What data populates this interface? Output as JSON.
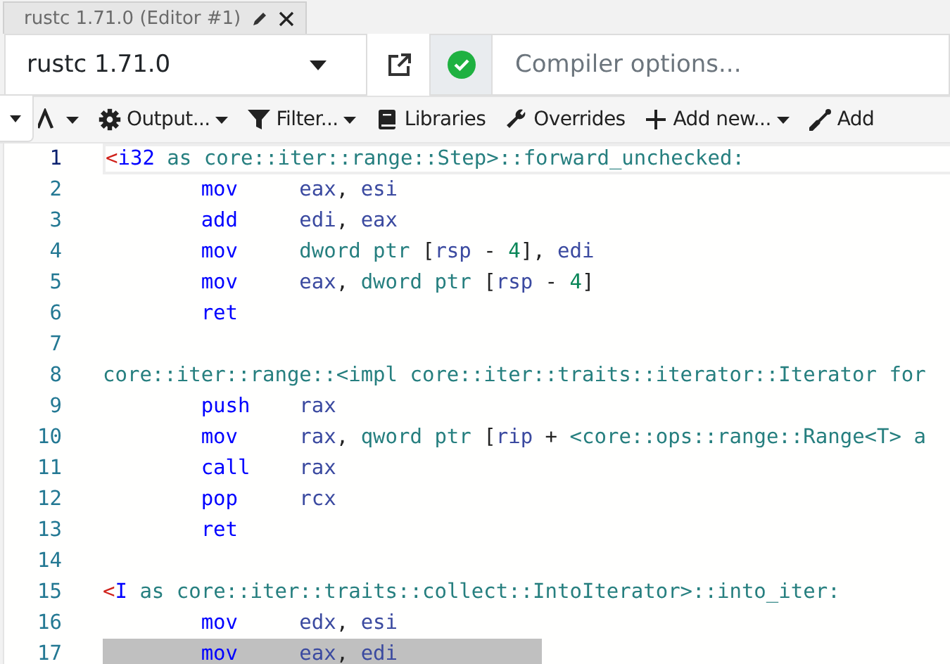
{
  "tab": {
    "title": "rustc 1.71.0 (Editor #1)"
  },
  "compiler": {
    "name": "rustc 1.71.0",
    "options_placeholder": "Compiler options..."
  },
  "toolbar": [
    {
      "dropdown": true
    },
    {
      "label": "Output...",
      "dropdown": true
    },
    {
      "label": "Filter...",
      "dropdown": true
    },
    {
      "label": "Libraries",
      "dropdown": false
    },
    {
      "label": "Overrides",
      "dropdown": false
    },
    {
      "label": "Add new...",
      "dropdown": true
    },
    {
      "label": "Add",
      "dropdown": false
    }
  ],
  "lines": [
    {
      "number": "1",
      "current": true,
      "highlighted": false,
      "kind": "label",
      "tokens": [
        {
          "kind": "angle",
          "text": "<"
        },
        {
          "kind": "type",
          "text": "i32"
        },
        {
          "kind": "name",
          "text": " as core::iter::range::Step>::forward_unchecked:"
        }
      ]
    },
    {
      "number": "2",
      "current": false,
      "highlighted": false,
      "kind": "instruction",
      "mnemonic": "mov",
      "tokens": [
        {
          "kind": "register",
          "text": "eax"
        },
        {
          "kind": "punct",
          "text": ", "
        },
        {
          "kind": "register",
          "text": "esi"
        }
      ]
    },
    {
      "number": "3",
      "current": false,
      "highlighted": false,
      "kind": "instruction",
      "mnemonic": "add",
      "tokens": [
        {
          "kind": "register",
          "text": "edi"
        },
        {
          "kind": "punct",
          "text": ", "
        },
        {
          "kind": "register",
          "text": "eax"
        }
      ]
    },
    {
      "number": "4",
      "current": false,
      "highlighted": false,
      "kind": "instruction",
      "mnemonic": "mov",
      "tokens": [
        {
          "kind": "name",
          "text": "dword ptr "
        },
        {
          "kind": "punct",
          "text": "["
        },
        {
          "kind": "register",
          "text": "rsp"
        },
        {
          "kind": "punct",
          "text": " - "
        },
        {
          "kind": "number",
          "text": "4"
        },
        {
          "kind": "punct",
          "text": "], "
        },
        {
          "kind": "register",
          "text": "edi"
        }
      ]
    },
    {
      "number": "5",
      "current": false,
      "highlighted": false,
      "kind": "instruction",
      "mnemonic": "mov",
      "tokens": [
        {
          "kind": "register",
          "text": "eax"
        },
        {
          "kind": "punct",
          "text": ", "
        },
        {
          "kind": "name",
          "text": "dword ptr "
        },
        {
          "kind": "punct",
          "text": "["
        },
        {
          "kind": "register",
          "text": "rsp"
        },
        {
          "kind": "punct",
          "text": " - "
        },
        {
          "kind": "number",
          "text": "4"
        },
        {
          "kind": "punct",
          "text": "]"
        }
      ]
    },
    {
      "number": "6",
      "current": false,
      "highlighted": false,
      "kind": "instruction",
      "mnemonic": "ret"
    },
    {
      "number": "7",
      "current": false,
      "highlighted": false,
      "kind": "blank"
    },
    {
      "number": "8",
      "current": false,
      "highlighted": false,
      "kind": "label",
      "tokens": [
        {
          "kind": "name",
          "text": "core::iter::range::<impl core::iter::traits::iterator::Iterator for"
        }
      ]
    },
    {
      "number": "9",
      "current": false,
      "highlighted": false,
      "kind": "instruction",
      "mnemonic": "push",
      "tokens": [
        {
          "kind": "register",
          "text": "rax"
        }
      ]
    },
    {
      "number": "10",
      "current": false,
      "highlighted": false,
      "kind": "instruction",
      "mnemonic": "mov",
      "tokens": [
        {
          "kind": "register",
          "text": "rax"
        },
        {
          "kind": "punct",
          "text": ", "
        },
        {
          "kind": "name",
          "text": "qword ptr "
        },
        {
          "kind": "punct",
          "text": "["
        },
        {
          "kind": "register",
          "text": "rip"
        },
        {
          "kind": "punct",
          "text": " + "
        },
        {
          "kind": "name",
          "text": "<core::ops::range::Range<T> a"
        }
      ]
    },
    {
      "number": "11",
      "current": false,
      "highlighted": false,
      "kind": "instruction",
      "mnemonic": "call",
      "tokens": [
        {
          "kind": "register",
          "text": "rax"
        }
      ]
    },
    {
      "number": "12",
      "current": false,
      "highlighted": false,
      "kind": "instruction",
      "mnemonic": "pop",
      "tokens": [
        {
          "kind": "register",
          "text": "rcx"
        }
      ]
    },
    {
      "number": "13",
      "current": false,
      "highlighted": false,
      "kind": "instruction",
      "mnemonic": "ret"
    },
    {
      "number": "14",
      "current": false,
      "highlighted": false,
      "kind": "blank"
    },
    {
      "number": "15",
      "current": false,
      "highlighted": false,
      "kind": "label",
      "tokens": [
        {
          "kind": "angle",
          "text": "<"
        },
        {
          "kind": "type",
          "text": "I"
        },
        {
          "kind": "name",
          "text": " as core::iter::traits::collect::IntoIterator>::into_iter:"
        }
      ]
    },
    {
      "number": "16",
      "current": false,
      "highlighted": false,
      "kind": "instruction",
      "mnemonic": "mov",
      "tokens": [
        {
          "kind": "register",
          "text": "edx"
        },
        {
          "kind": "punct",
          "text": ", "
        },
        {
          "kind": "register",
          "text": "esi"
        }
      ]
    },
    {
      "number": "17",
      "current": false,
      "highlighted": true,
      "kind": "instruction",
      "mnemonic": "mov",
      "tokens": [
        {
          "kind": "register",
          "text": "eax"
        },
        {
          "kind": "punct",
          "text": ", "
        },
        {
          "kind": "register",
          "text": "edi"
        }
      ]
    }
  ]
}
